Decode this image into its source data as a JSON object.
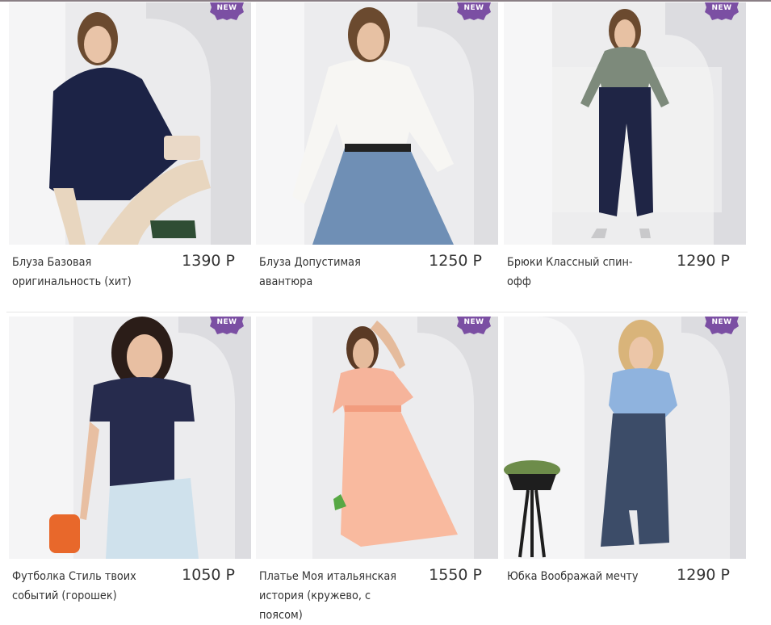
{
  "badge_label": "NEW",
  "products": [
    {
      "name": "Блуза Базовая оригинальность (хит)",
      "price": "1390 Р",
      "photo": "woman-navy-blouse-beige-trousers"
    },
    {
      "name": "Блуза Допустимая авантюра",
      "price": "1250 Р",
      "photo": "woman-white-blouse-jeans"
    },
    {
      "name": "Брюки Классный спин-офф",
      "price": "1290 Р",
      "photo": "woman-grey-top-navy-trousers"
    },
    {
      "name": "Футболка Стиль твоих событий (горошек)",
      "price": "1050 Р",
      "photo": "woman-polka-dot-tshirt-orange-bag"
    },
    {
      "name": "Платье Моя итальянская история (кружево, с поясом)",
      "price": "1550 Р",
      "photo": "woman-peach-lace-dress"
    },
    {
      "name": "Юбка Воображай мечту",
      "price": "1290 Р",
      "photo": "woman-blue-shirt-denim-skirt"
    }
  ],
  "colors": {
    "badge": "#7b4fa3",
    "text": "#333333",
    "photo_bg": "#e9e9ea"
  }
}
